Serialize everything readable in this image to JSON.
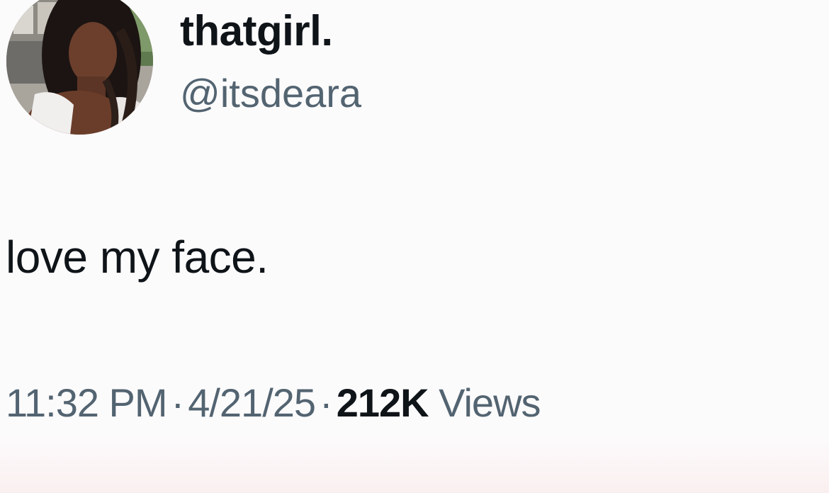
{
  "tweet": {
    "display_name": "thatgirl.",
    "handle": "@itsdeara",
    "text": "love my face.",
    "time": "11:32 PM",
    "date": "4/21/25",
    "separator": "·",
    "views_count": "212K",
    "views_label": "Views"
  },
  "colors": {
    "background": "#fcfbfc",
    "primary_text": "#0f1419",
    "secondary_text": "#536471"
  }
}
